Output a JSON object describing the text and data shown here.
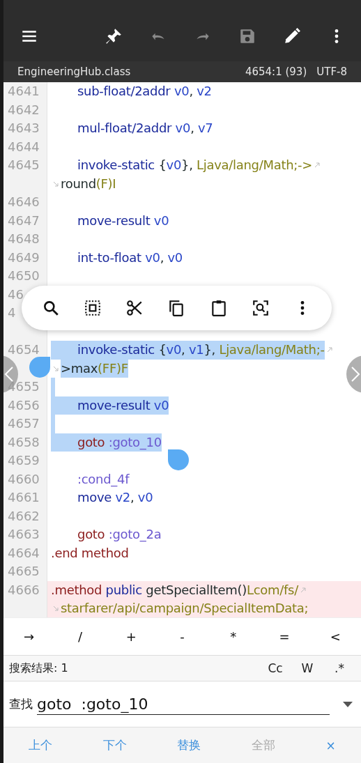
{
  "toolbar": [
    {
      "kind": "menu",
      "disabled": false
    },
    {
      "kind": "pin",
      "disabled": false
    },
    {
      "kind": "undo",
      "disabled": true
    },
    {
      "kind": "redo",
      "disabled": true
    },
    {
      "kind": "save",
      "disabled": true
    },
    {
      "kind": "edit",
      "disabled": false
    },
    {
      "kind": "more",
      "disabled": false
    }
  ],
  "file_bar": {
    "filename": "EngineeringHub.class",
    "position": "4654:1 (93)",
    "encoding": "UTF-8"
  },
  "lines": [
    {
      "number": "4641",
      "kind": "instruction",
      "selected": false,
      "highlighted": false,
      "rows": [
        {
          "tokens": [
            {
              "text": "sub-float/2addr",
              "kind": "op"
            },
            {
              "text": "v0",
              "kind": "reg"
            },
            {
              "text": ",",
              "kind": "close"
            },
            {
              "text": "v2",
              "kind": "reg"
            }
          ]
        }
      ]
    },
    {
      "number": "4642",
      "kind": "instruction",
      "selected": false,
      "highlighted": false
    },
    {
      "number": "4643",
      "kind": "instruction",
      "selected": false,
      "highlighted": false,
      "rows": [
        {
          "tokens": [
            {
              "text": "mul-float/2addr",
              "kind": "op"
            },
            {
              "text": "v0",
              "kind": "reg"
            },
            {
              "text": ",",
              "kind": "close"
            },
            {
              "text": "v7",
              "kind": "reg"
            }
          ]
        }
      ]
    },
    {
      "number": "4644",
      "kind": "instruction",
      "selected": false,
      "highlighted": false
    },
    {
      "number": "4645",
      "kind": "instruction",
      "selected": false,
      "highlighted": false,
      "rows": [
        {
          "tokens": [
            {
              "text": "invoke-static",
              "kind": "op"
            },
            {
              "text": "{",
              "kind": "open"
            },
            {
              "text": "v0",
              "kind": "reg"
            },
            {
              "text": "},",
              "kind": "close"
            },
            {
              "text": "Ljava/lang/Math;->",
              "kind": "type"
            }
          ]
        },
        {
          "tokens": [
            {
              "text": "round",
              "kind": "plain"
            },
            {
              "text": "(F)I",
              "kind": "suffix"
            }
          ]
        }
      ]
    },
    {
      "number": "4646",
      "kind": "instruction",
      "selected": false,
      "highlighted": false
    },
    {
      "number": "4647",
      "kind": "instruction",
      "selected": false,
      "highlighted": false,
      "rows": [
        {
          "tokens": [
            {
              "text": "move-result",
              "kind": "op"
            },
            {
              "text": "v0",
              "kind": "reg"
            }
          ]
        }
      ]
    },
    {
      "number": "4648",
      "kind": "instruction",
      "selected": false,
      "highlighted": false
    },
    {
      "number": "4649",
      "kind": "instruction",
      "selected": false,
      "highlighted": false,
      "rows": [
        {
          "tokens": [
            {
              "text": "int-to-float",
              "kind": "op"
            },
            {
              "text": "v0",
              "kind": "reg"
            },
            {
              "text": ",",
              "kind": "close"
            },
            {
              "text": "v0",
              "kind": "reg"
            }
          ]
        }
      ]
    },
    {
      "number": "4650",
      "kind": "instruction",
      "selected": false,
      "highlighted": false
    },
    {
      "number": "46",
      "kind": "instruction",
      "highlighted": false
    },
    {
      "number": "4",
      "kind": "instruction",
      "highlighted": false
    },
    {
      "kind": "instruction",
      "highlighted": false
    },
    {
      "number": "4654",
      "kind": "instruction",
      "selected": true,
      "highlighted": false,
      "rows": [
        {
          "tokens": [
            {
              "text": "invoke-static",
              "kind": "op"
            },
            {
              "text": "{",
              "kind": "open"
            },
            {
              "text": "v0",
              "kind": "reg"
            },
            {
              "text": ",",
              "kind": "close"
            },
            {
              "text": "v1",
              "kind": "reg"
            },
            {
              "text": "},",
              "kind": "close"
            },
            {
              "text": "Ljava/lang/Math;-",
              "kind": "type"
            }
          ]
        },
        {
          "tokens": [
            {
              "text": ">max",
              "kind": "plain"
            },
            {
              "text": "(FF)F",
              "kind": "suffix"
            }
          ]
        }
      ]
    },
    {
      "number": "4655",
      "kind": "instruction",
      "selected": true,
      "highlighted": false
    },
    {
      "number": "4656",
      "kind": "instruction",
      "selected": true,
      "highlighted": false,
      "rows": [
        {
          "tokens": [
            {
              "text": "move-result",
              "kind": "op"
            },
            {
              "text": "v0",
              "kind": "reg"
            }
          ]
        }
      ]
    },
    {
      "number": "4657",
      "kind": "instruction",
      "selected": true,
      "highlighted": false
    },
    {
      "number": "4658",
      "kind": "instruction",
      "selected": true,
      "highlighted": false,
      "rows": [
        {
          "tokens": [
            {
              "text": "goto",
              "kind": "keyword"
            },
            {
              "text": ":goto_10",
              "kind": "label"
            }
          ]
        }
      ]
    },
    {
      "number": "4659",
      "kind": "instruction",
      "selected": false,
      "highlighted": false
    },
    {
      "number": "4660",
      "kind": "instruction",
      "selected": false,
      "highlighted": false,
      "rows": [
        {
          "tokens": [
            {
              "text": ":cond_4f",
              "kind": "label"
            }
          ]
        }
      ]
    },
    {
      "number": "4661",
      "kind": "instruction",
      "selected": false,
      "highlighted": false,
      "rows": [
        {
          "tokens": [
            {
              "text": "move",
              "kind": "op"
            },
            {
              "text": "v2",
              "kind": "reg"
            },
            {
              "text": ",",
              "kind": "close"
            },
            {
              "text": "v0",
              "kind": "reg"
            }
          ]
        }
      ]
    },
    {
      "number": "4662",
      "kind": "instruction",
      "selected": false,
      "highlighted": false
    },
    {
      "number": "4663",
      "kind": "instruction",
      "selected": false,
      "highlighted": false,
      "rows": [
        {
          "tokens": [
            {
              "text": "goto",
              "kind": "keyword"
            },
            {
              "text": ":goto_2a",
              "kind": "label"
            }
          ]
        }
      ]
    },
    {
      "number": "4664",
      "kind": "directive",
      "selected": false,
      "highlighted": false,
      "rows": [
        {
          "tokens": [
            {
              "text": ".end",
              "kind": "keyword"
            },
            {
              "text": "method",
              "kind": "keyword"
            }
          ]
        }
      ]
    },
    {
      "number": "4665",
      "kind": "directive",
      "selected": false,
      "highlighted": false
    },
    {
      "number": "4666",
      "kind": "directive",
      "selected": false,
      "highlighted": true,
      "rows": [
        {
          "tokens": [
            {
              "text": ".method",
              "kind": "keyword"
            },
            {
              "text": "public",
              "kind": "op"
            },
            {
              "text": "getSpecialItem()",
              "kind": "plain"
            },
            {
              "text": "Lcom/fs/",
              "kind": "suffix"
            }
          ]
        },
        {
          "tokens": [
            {
              "text": "starfarer/api/campaign/SpecialItemData;",
              "kind": "type"
            }
          ]
        }
      ]
    }
  ],
  "context_menu": [
    {
      "kind": "search"
    },
    {
      "kind": "select-all"
    },
    {
      "kind": "cut"
    },
    {
      "kind": "copy"
    },
    {
      "kind": "paste"
    },
    {
      "kind": "lens"
    },
    {
      "kind": "more"
    }
  ],
  "symbols": [
    "→",
    "/",
    "+",
    "-",
    "*",
    "=",
    "<"
  ],
  "search": {
    "results": "搜索结果: 1",
    "options": [
      "Cc",
      "W",
      ".*"
    ],
    "find_label": "查找",
    "find_value": "goto  :goto_10"
  },
  "actions": [
    {
      "label": "上个",
      "disabled": false
    },
    {
      "label": "下个",
      "disabled": false
    },
    {
      "label": "替换",
      "disabled": false
    },
    {
      "label": "全部",
      "disabled": true
    },
    {
      "label": "×",
      "disabled": false
    }
  ]
}
